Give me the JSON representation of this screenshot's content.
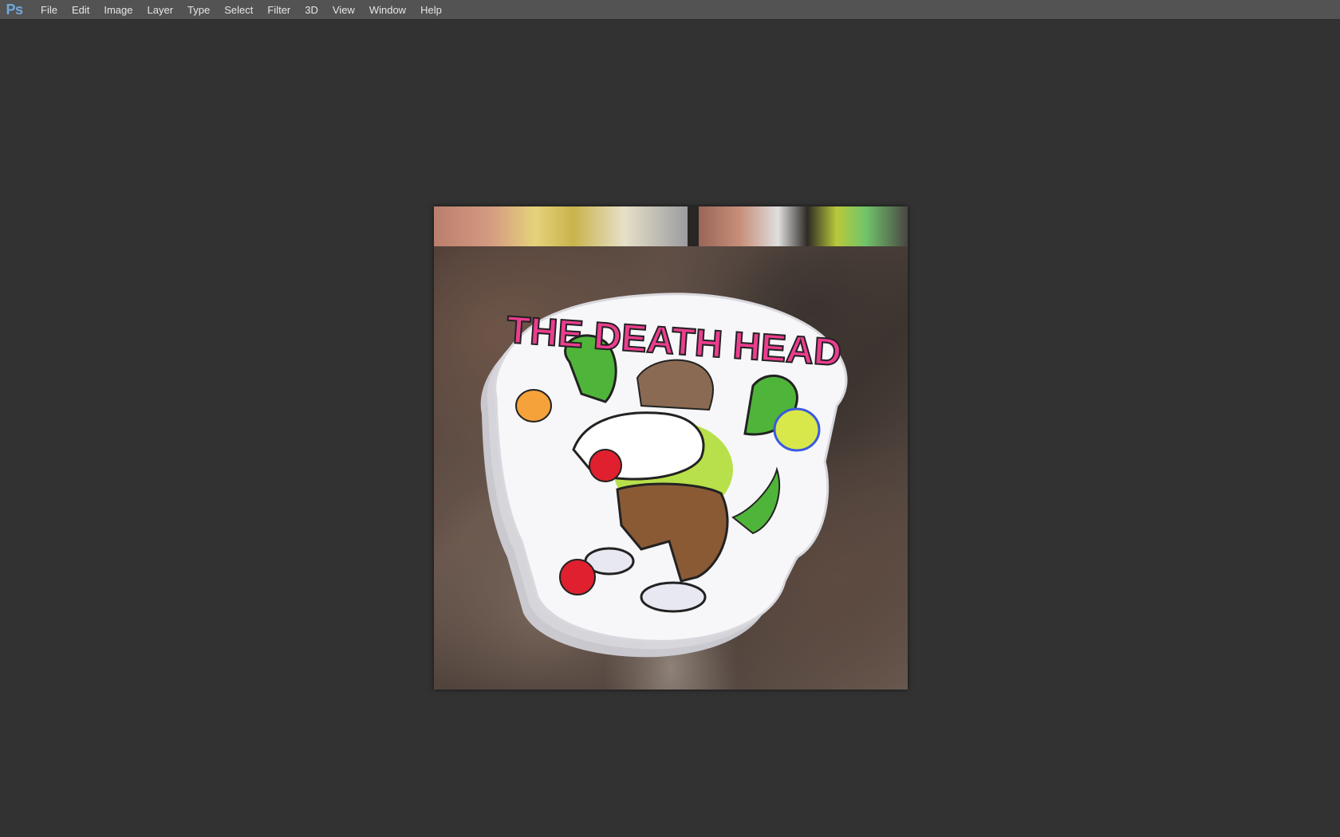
{
  "app": {
    "logo_text": "Ps",
    "logo_color": "#6fa8dc",
    "menubar_color": "#535353",
    "workspace_color": "#323232"
  },
  "menu": {
    "items": [
      {
        "label": "File"
      },
      {
        "label": "Edit"
      },
      {
        "label": "Image"
      },
      {
        "label": "Layer"
      },
      {
        "label": "Type"
      },
      {
        "label": "Select"
      },
      {
        "label": "Filter"
      },
      {
        "label": "3D"
      },
      {
        "label": "View"
      },
      {
        "label": "Window"
      },
      {
        "label": "Help"
      }
    ]
  },
  "document": {
    "sticker_text": "THE DEATH HEAD",
    "sticker_text_color": "#ec3d8f"
  }
}
